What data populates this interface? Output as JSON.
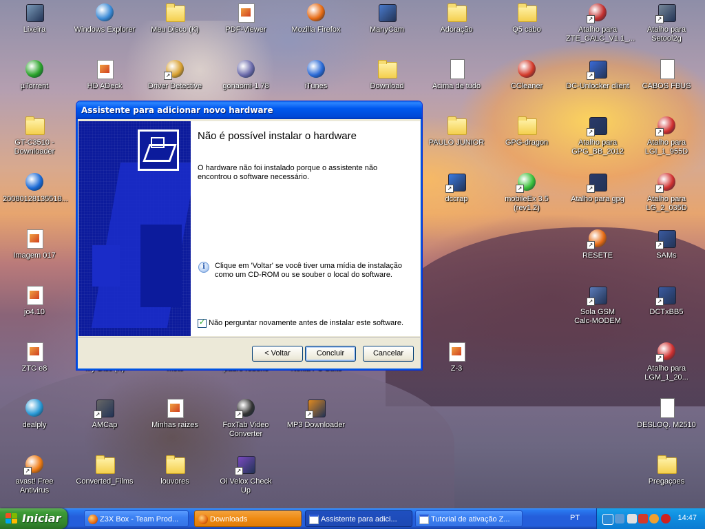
{
  "desktop": {
    "icons": [
      {
        "name": "lixeira-icon",
        "label": "Lixeira",
        "kind": "box",
        "color": "#7a9ab8",
        "shortcut": false
      },
      {
        "name": "windows-explorer-icon",
        "label": "Windows Explorer",
        "kind": "orb",
        "color": "#3a8ad6",
        "shortcut": false
      },
      {
        "name": "meu-disco-icon",
        "label": "Meu Disco (K)",
        "kind": "folder",
        "color": "",
        "shortcut": false
      },
      {
        "name": "pdf-viewer-icon",
        "label": "PDF-Viewer",
        "kind": "app",
        "color": "#cc2222",
        "shortcut": false
      },
      {
        "name": "mozilla-firefox-icon",
        "label": "Mozilla Firefox",
        "kind": "orb",
        "color": "#e66a12",
        "shortcut": false
      },
      {
        "name": "manycam-icon",
        "label": "ManyCam",
        "kind": "box",
        "color": "#4a7acc",
        "shortcut": false
      },
      {
        "name": "adoracao-icon",
        "label": "Adoração",
        "kind": "folder",
        "color": "",
        "shortcut": false
      },
      {
        "name": "q5-cabo-icon",
        "label": "Q5 cabo",
        "kind": "folder",
        "color": "",
        "shortcut": false
      },
      {
        "name": "zte-calc-icon",
        "label": "Atalho para\nZTE_CALC_V1.1_...",
        "kind": "orb",
        "color": "#c23030",
        "shortcut": true
      },
      {
        "name": "setool2g-icon",
        "label": "Atalho para\nSetool2g",
        "kind": "box",
        "color": "#778899",
        "shortcut": true
      },
      {
        "name": "utorrent-icon",
        "label": "µTorrent",
        "kind": "orb",
        "color": "#2aa32a",
        "shortcut": false
      },
      {
        "name": "hd-adeck-icon",
        "label": "HD ADeck",
        "kind": "app",
        "color": "#d05020",
        "shortcut": false
      },
      {
        "name": "driver-detective-icon",
        "label": "Driver Detective",
        "kind": "orb",
        "color": "#d8a030",
        "shortcut": true
      },
      {
        "name": "gonaomi-icon",
        "label": "gonaomi-1.78",
        "kind": "orb",
        "color": "#6a6aaa",
        "shortcut": false
      },
      {
        "name": "itunes-icon",
        "label": "iTunes",
        "kind": "orb",
        "color": "#2a6ad6",
        "shortcut": false
      },
      {
        "name": "download-folder-icon",
        "label": "Download",
        "kind": "folder",
        "color": "",
        "shortcut": false
      },
      {
        "name": "acima-de-tudo-icon",
        "label": "Acima de tudo",
        "kind": "doc",
        "color": "",
        "shortcut": false
      },
      {
        "name": "ccleaner-icon",
        "label": "CCleaner",
        "kind": "orb",
        "color": "#d33a2a",
        "shortcut": false
      },
      {
        "name": "dc-unlocker-icon",
        "label": "DC-Unlocker client",
        "kind": "box",
        "color": "#3a6ad6",
        "shortcut": true
      },
      {
        "name": "cabos-fbus-icon",
        "label": "CABOS FBUS",
        "kind": "doc",
        "color": "",
        "shortcut": false
      },
      {
        "name": "gt-c3510-icon",
        "label": "GT-C3510 -\nDownloader",
        "kind": "folder",
        "color": "",
        "shortcut": false
      },
      {
        "name": "paulo-junior-icon",
        "label": "PAULO JUNIOR",
        "kind": "folder",
        "color": "",
        "shortcut": false
      },
      {
        "name": "gpg-dragon-icon",
        "label": "GPG-dragon",
        "kind": "folder",
        "color": "",
        "shortcut": false
      },
      {
        "name": "gpg-bb-icon",
        "label": "Atalho para\nGPG_BB_2012",
        "kind": "box",
        "color": "#2a3a6a",
        "shortcut": true
      },
      {
        "name": "lgi-icon",
        "label": "Atalho para\nLGI_1_955D",
        "kind": "orb",
        "color": "#d03030",
        "shortcut": true
      },
      {
        "name": "file-2008-icon",
        "label": "20080128135518...",
        "kind": "orb",
        "color": "#1a6ad6",
        "shortcut": false
      },
      {
        "name": "dccrap-icon",
        "label": "dccrap",
        "kind": "box",
        "color": "#3a7ae0",
        "shortcut": true
      },
      {
        "name": "mobileex-icon",
        "label": "mobileEx 3.5\n(rev1.2)",
        "kind": "orb",
        "color": "#3ac03a",
        "shortcut": true
      },
      {
        "name": "atalho-gpg-icon",
        "label": "Atalho para gpg",
        "kind": "box",
        "color": "#2a3a6a",
        "shortcut": true
      },
      {
        "name": "lg2-icon",
        "label": "Atalho para\nLG_2_035D",
        "kind": "orb",
        "color": "#d03030",
        "shortcut": true
      },
      {
        "name": "imagem-017-icon",
        "label": "Imagem 017",
        "kind": "app",
        "color": "",
        "shortcut": false
      },
      {
        "name": "resete-icon",
        "label": "RESETE",
        "kind": "orb",
        "color": "#e66a12",
        "shortcut": true
      },
      {
        "name": "sams-icon",
        "label": "SAMs",
        "kind": "box",
        "color": "#3a5aa0",
        "shortcut": true
      },
      {
        "name": "jo4-icon",
        "label": "jo4.10",
        "kind": "app",
        "color": "",
        "shortcut": false
      },
      {
        "name": "sola-gsm-icon",
        "label": "Sola GSM\nCalc-MODEM",
        "kind": "box",
        "color": "#5a7ab8",
        "shortcut": true
      },
      {
        "name": "dctxbb5-icon",
        "label": "DCTxBB5",
        "kind": "box",
        "color": "#3a5aa0",
        "shortcut": true
      },
      {
        "name": "ztc-e8-icon",
        "label": "ZTC  e8",
        "kind": "app",
        "color": "",
        "shortcut": false
      },
      {
        "name": "my-disc-icon",
        "label": "My Disc (K)",
        "kind": "folder",
        "color": "",
        "shortcut": false
      },
      {
        "name": "moto-icon",
        "label": "moto",
        "kind": "folder",
        "color": "",
        "shortcut": false
      },
      {
        "name": "padre-roberio-icon",
        "label": "padre roberio",
        "kind": "folder",
        "color": "",
        "shortcut": false
      },
      {
        "name": "nokia-pc-suite-icon",
        "label": "Nokia PC Suite",
        "kind": "orb",
        "color": "#2a5ad6",
        "shortcut": false
      },
      {
        "name": "z3-icon",
        "label": "Z-3",
        "kind": "app",
        "color": "",
        "shortcut": false
      },
      {
        "name": "lgm-icon",
        "label": "Atalho para\nLGM_1_20...",
        "kind": "orb",
        "color": "#d03030",
        "shortcut": true
      },
      {
        "name": "dealply-icon",
        "label": "dealply",
        "kind": "orb",
        "color": "#2a9ad6",
        "shortcut": false
      },
      {
        "name": "amcap-icon",
        "label": "AMCap",
        "kind": "box",
        "color": "#666666",
        "shortcut": true
      },
      {
        "name": "minhas-raizes-icon",
        "label": "Minhas raizes",
        "kind": "app",
        "color": "",
        "shortcut": false
      },
      {
        "name": "foxtab-icon",
        "label": "FoxTab Video\nConverter",
        "kind": "orb",
        "color": "#333333",
        "shortcut": true
      },
      {
        "name": "mp3-downloader-icon",
        "label": "MP3 Downloader",
        "kind": "box",
        "color": "#e08a20",
        "shortcut": true
      },
      {
        "name": "desloq-icon",
        "label": "DESLOQ. M2510",
        "kind": "doc",
        "color": "",
        "shortcut": false
      },
      {
        "name": "avast-icon",
        "label": "avast! Free\nAntivirus",
        "kind": "orb",
        "color": "#ee7a12",
        "shortcut": true
      },
      {
        "name": "converted-films-icon",
        "label": "Converted_Films",
        "kind": "folder",
        "color": "",
        "shortcut": false
      },
      {
        "name": "louvores-icon",
        "label": "louvores",
        "kind": "folder",
        "color": "",
        "shortcut": false
      },
      {
        "name": "oi-velox-icon",
        "label": "Oi Velox Check Up",
        "kind": "box",
        "color": "#7a4ac0",
        "shortcut": true
      },
      {
        "name": "pregacoes-icon",
        "label": "Pregaçoes",
        "kind": "folder",
        "color": "",
        "shortcut": false
      }
    ]
  },
  "dialog": {
    "title": "Assistente para adicionar novo hardware",
    "heading": "Não é possível instalar o hardware",
    "body": "O hardware não foi instalado porque o assistente não encontrou o software necessário.",
    "info": "Clique em 'Voltar' se você tiver uma mídia de instalação como um CD-ROM ou se souber o local do software.",
    "checkbox_label": "Não perguntar novamente antes de instalar este software.",
    "checkbox_checked": true,
    "buttons": {
      "back": "< Voltar",
      "finish": "Concluir",
      "cancel": "Cancelar"
    }
  },
  "taskbar": {
    "start_label": "Iniciar",
    "buttons": [
      {
        "label": "Z3X Box - Team Prod...",
        "state": "normal",
        "icon": "firefox-icon"
      },
      {
        "label": "Downloads",
        "state": "active",
        "icon": "firefox-icon"
      },
      {
        "label": "Assistente para adici...",
        "state": "pressed",
        "icon": "window-icon"
      },
      {
        "label": "Tutorial de ativação Z...",
        "state": "normal",
        "icon": "window-icon"
      }
    ],
    "language": "PT",
    "clock": "14:47"
  }
}
